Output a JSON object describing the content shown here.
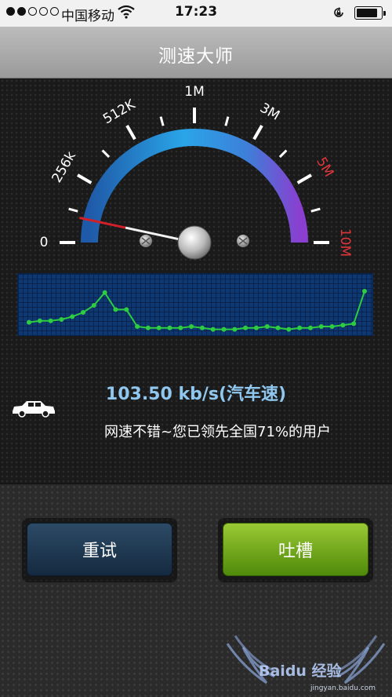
{
  "status_bar": {
    "signal_dots": [
      true,
      true,
      false,
      false,
      false
    ],
    "carrier": "中国移动",
    "time": "17:23",
    "icons": [
      "wifi-icon",
      "rotation-lock-icon",
      "battery-icon"
    ],
    "battery_level": 0.85
  },
  "app": {
    "title": "测速大师"
  },
  "gauge": {
    "scale_labels": [
      "0",
      "256k",
      "512K",
      "1M",
      "3M",
      "5M",
      "10M"
    ],
    "label_colors": [
      "#ffffff",
      "#ffffff",
      "#ffffff",
      "#ffffff",
      "#ffffff",
      "#e0363b",
      "#e0363b"
    ],
    "needle_value_kbps": 103.5
  },
  "graph": {
    "values": [
      8,
      9,
      9,
      10,
      12,
      15,
      20,
      29,
      17,
      17,
      5,
      4,
      4,
      4,
      4,
      5,
      4,
      3,
      3,
      3,
      4,
      4,
      5,
      4,
      3,
      4,
      4,
      5,
      5,
      6,
      7,
      30
    ],
    "line_color": "#2ecc40"
  },
  "result": {
    "speed": "103.50 kb/s(汽车速)",
    "rank": "网速不错~您已领先全国71%的用户",
    "vehicle_icon": "car-icon"
  },
  "buttons": {
    "retry": "重试",
    "rant": "吐槽"
  },
  "watermark": {
    "logo": "Baidu 经验",
    "url": "jingyan.baidu.com"
  }
}
